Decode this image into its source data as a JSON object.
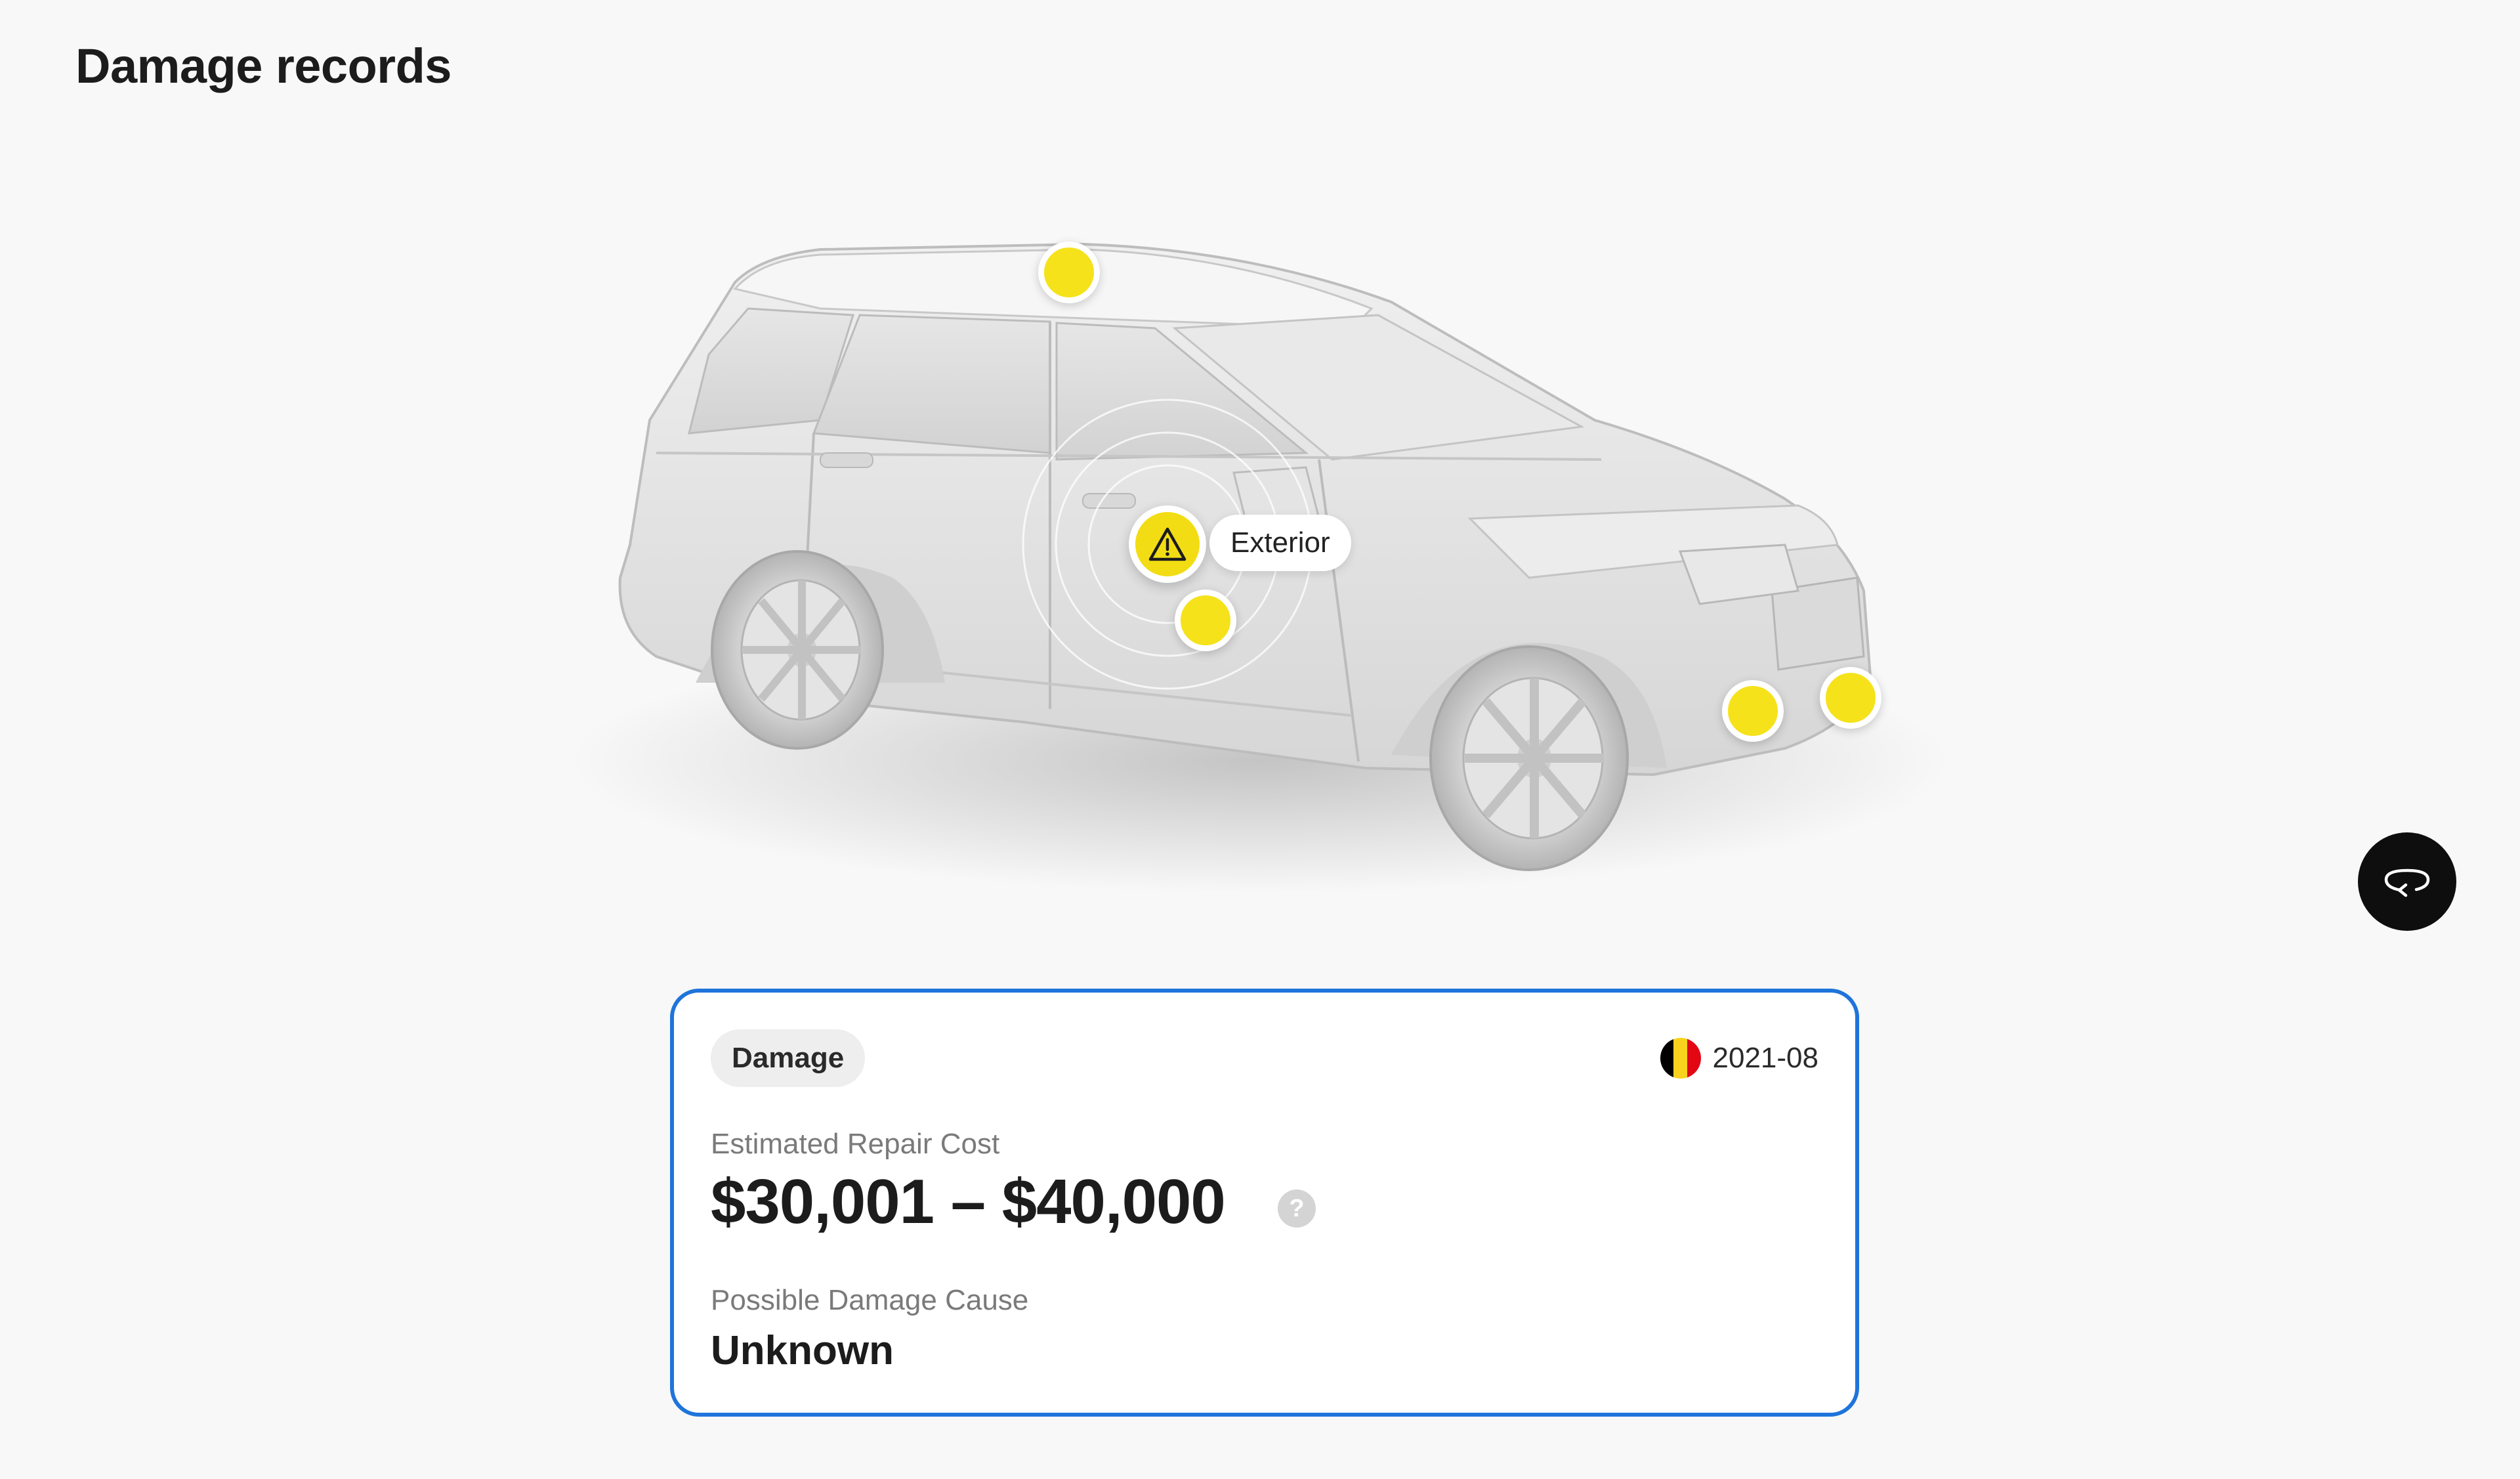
{
  "page": {
    "title": "Damage records"
  },
  "vehicle_view": {
    "active_area_label": "Exterior",
    "hotspots": [
      "roof",
      "door",
      "front-bumper-left",
      "front-bumper-right"
    ],
    "hotspot_color": "#f5e21a",
    "rotate_icon": "rotate-360-icon"
  },
  "record": {
    "type_badge": "Damage",
    "country_flag": "belgium-flag",
    "date": "2021-08",
    "cost_label": "Estimated Repair Cost",
    "cost_value": "$30,001 – $40,000",
    "help_icon_text": "?",
    "cause_label": "Possible Damage Cause",
    "cause_value": "Unknown",
    "border_color": "#1f74db"
  }
}
